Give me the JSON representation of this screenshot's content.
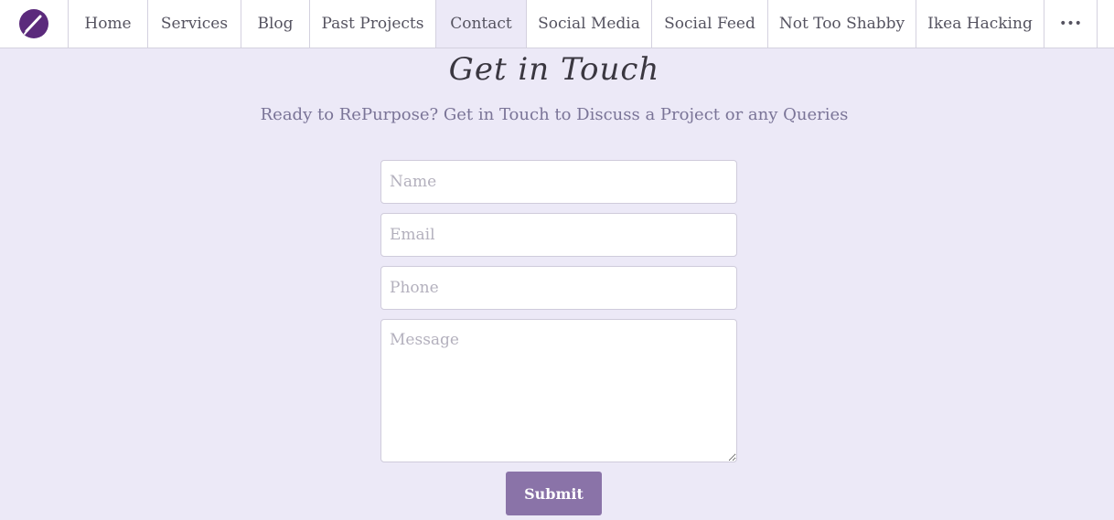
{
  "nav": {
    "items": [
      {
        "label": "Home"
      },
      {
        "label": "Services"
      },
      {
        "label": "Blog"
      },
      {
        "label": "Past Projects"
      },
      {
        "label": "Contact"
      },
      {
        "label": "Social Media"
      },
      {
        "label": "Social Feed"
      },
      {
        "label": "Not Too Shabby"
      },
      {
        "label": "Ikea Hacking"
      },
      {
        "label": "•••"
      }
    ],
    "active": "Contact"
  },
  "page": {
    "title": "Get in Touch",
    "subtitle": "Ready to RePurpose? Get in Touch to Discuss a Project or any Queries"
  },
  "form": {
    "name_placeholder": "Name",
    "email_placeholder": "Email",
    "phone_placeholder": "Phone",
    "message_placeholder": "Message",
    "submit_label": "Submit"
  },
  "colors": {
    "background": "#ece9f7",
    "brand": "#5b2a7c",
    "button": "#8a73a8"
  }
}
